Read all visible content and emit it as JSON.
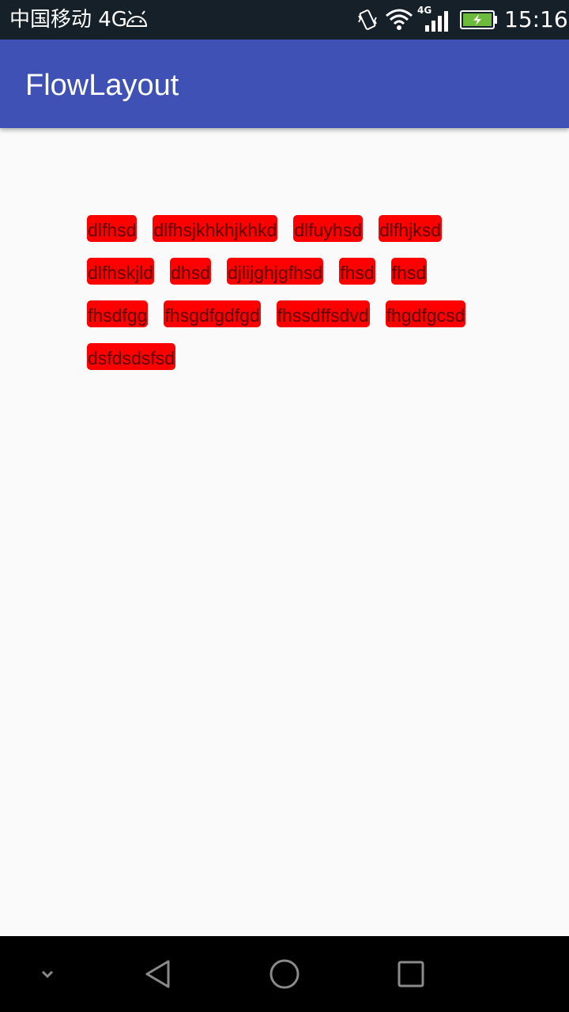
{
  "status_bar": {
    "carrier": "中国移动 4G",
    "network_label": "4G",
    "time": "15:16",
    "icons": [
      "android-icon",
      "vibrate-icon",
      "wifi-icon",
      "signal-icon",
      "battery-charging-icon"
    ]
  },
  "app_bar": {
    "title": "FlowLayout",
    "color": "#3f51b5"
  },
  "flow_layout": {
    "tag_color": "#ff0000",
    "tags": [
      "dlfhsd",
      "dlfhsjkhkhjkhkd",
      "dlfuyhsd",
      "dlfhjksd",
      "dlfhskjld",
      "dhsd",
      "djlijghjgfhsd",
      "fhsd",
      "fhsd",
      "fhsdfgg",
      "fhsgdfgdfgd",
      "fhssdffsdvd",
      "fhgdfgcsd",
      "dsfdsdsfsd"
    ]
  },
  "nav_bar": {
    "icons": [
      "chevron-down-icon",
      "back-icon",
      "home-icon",
      "recent-apps-icon"
    ]
  }
}
